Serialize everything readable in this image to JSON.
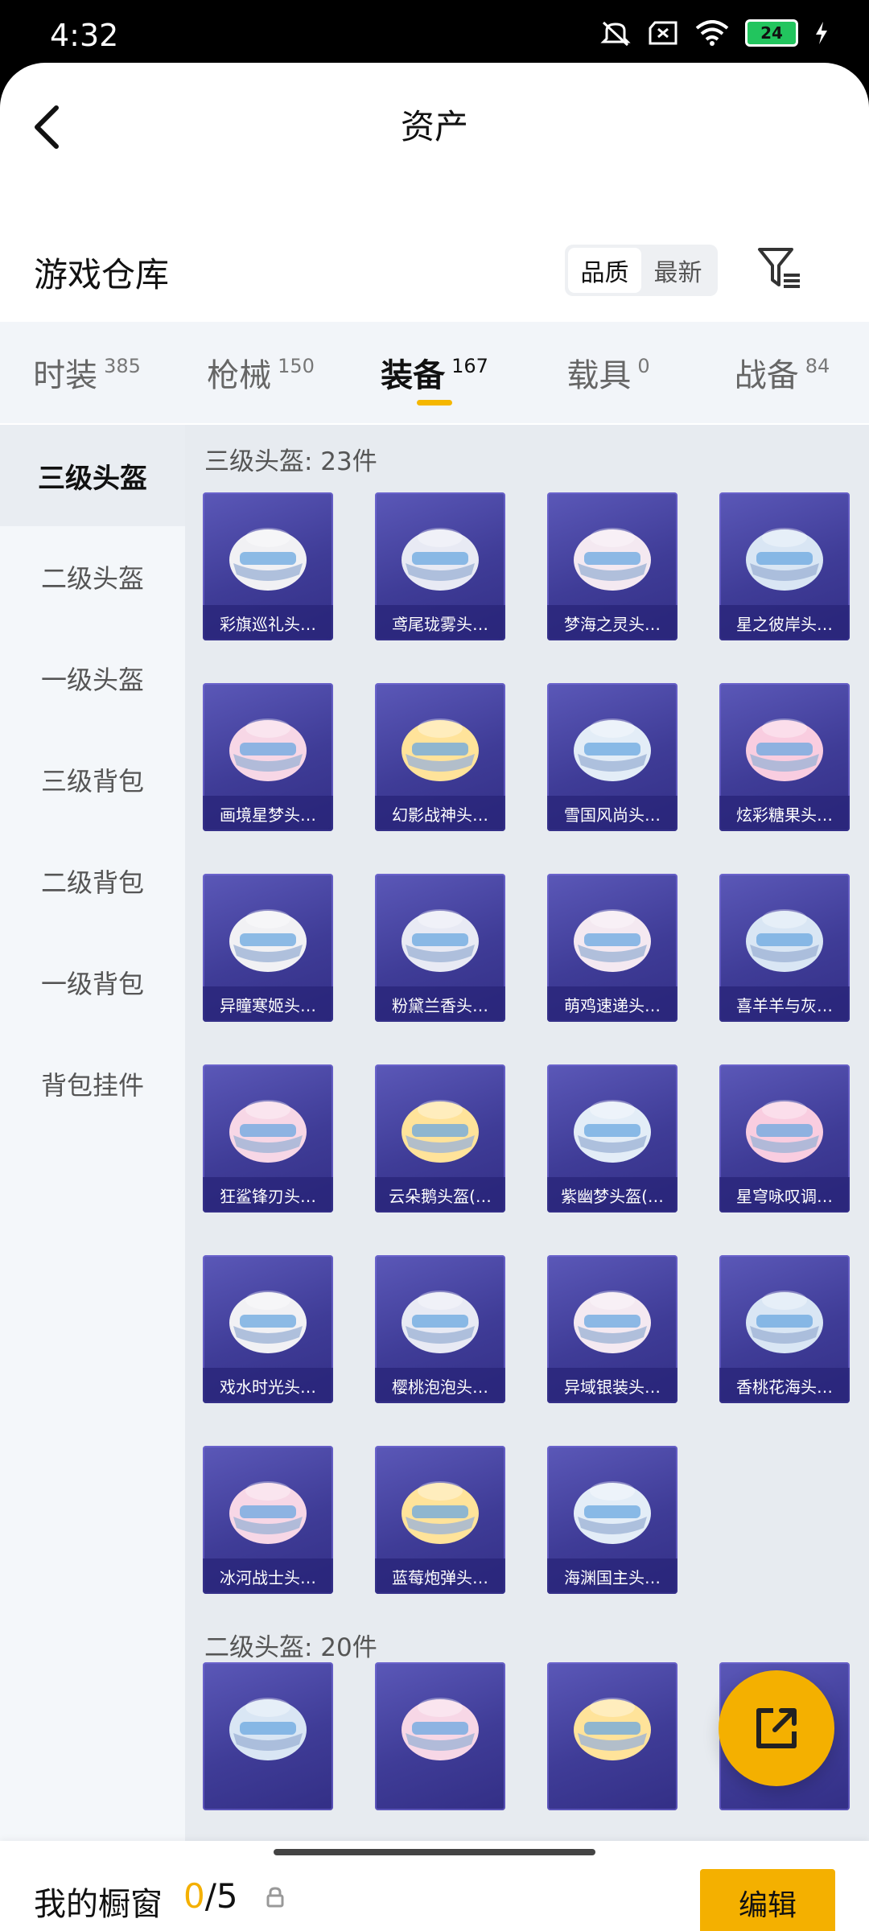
{
  "status": {
    "time": "4:32",
    "battery": "24"
  },
  "header": {
    "title": "资产"
  },
  "repo": {
    "title": "游戏仓库",
    "sort_options": [
      "品质",
      "最新"
    ],
    "sort_active": 0
  },
  "tabs": [
    {
      "label": "时装",
      "count": "385"
    },
    {
      "label": "枪械",
      "count": "150"
    },
    {
      "label": "装备",
      "count": "167",
      "active": true
    },
    {
      "label": "载具",
      "count": "0"
    },
    {
      "label": "战备",
      "count": "84"
    }
  ],
  "sidebar": {
    "items": [
      "三级头盔",
      "二级头盔",
      "一级头盔",
      "三级背包",
      "二级背包",
      "一级背包",
      "背包挂件"
    ],
    "active": 0
  },
  "sections": [
    {
      "title": "三级头盔: 23件",
      "items": [
        "彩旗巡礼头…",
        "鸢尾珑雾头…",
        "梦海之灵头…",
        "星之彼岸头…",
        "画境星梦头…",
        "幻影战神头…",
        "雪国风尚头…",
        "炫彩糖果头…",
        "异瞳寒姬头…",
        "粉黛兰香头…",
        "萌鸡速递头…",
        "喜羊羊与灰…",
        "狂鲨锋刃头…",
        "云朵鹅头盔(…",
        "紫幽梦头盔(…",
        "星穹咏叹调…",
        "戏水时光头…",
        "樱桃泡泡头…",
        "异域银装头…",
        "香桃花海头…",
        "冰河战士头…",
        "蓝莓炮弹头…",
        "海渊国主头…"
      ]
    },
    {
      "title": "二级头盔: 20件"
    }
  ],
  "showcase": {
    "label": "我的橱窗",
    "used": "0",
    "total": "/5",
    "edit_label": "编辑"
  },
  "colors": {
    "accent": "#f4b000",
    "card_bg": "#3f3c97"
  }
}
